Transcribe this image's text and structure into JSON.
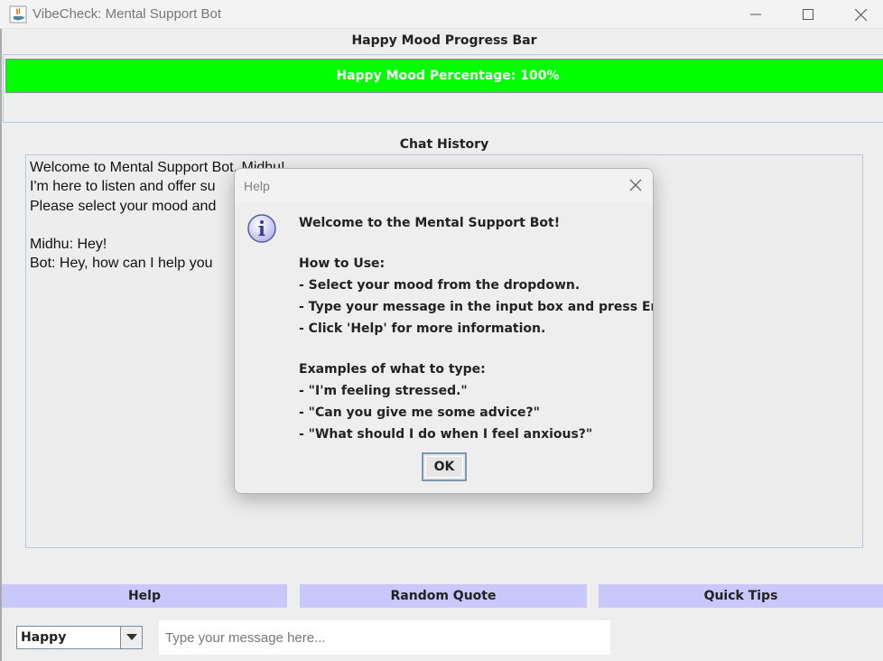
{
  "window": {
    "title": "VibeCheck: Mental Support Bot",
    "minimize_glyph": "—",
    "close_glyph": "✕"
  },
  "progress": {
    "title": "Happy Mood Progress Bar",
    "value_percent": 100,
    "label": "Happy Mood Percentage: 100%",
    "color": "#00ff00"
  },
  "chat": {
    "title": "Chat History",
    "lines": [
      "Welcome to Mental Support Bot, Midhu!",
      "I'm here to listen and offer su",
      "Please select your mood and",
      "",
      "Midhu: Hey!",
      "Bot: Hey, how can I help you"
    ]
  },
  "buttons": {
    "help": "Help",
    "random_quote": "Random Quote",
    "quick_tips": "Quick Tips",
    "color": "#c8c8fa"
  },
  "mood": {
    "selected": "Happy"
  },
  "input": {
    "placeholder": "Type your message here..."
  },
  "dialog": {
    "title": "Help",
    "heading": "Welcome to the Mental Support Bot!",
    "how_to_title": "How to Use:",
    "how_to": [
      "- Select your mood from the dropdown.",
      "- Type your message in the input box and press Enter.",
      "- Click 'Help' for more information."
    ],
    "examples_title": "Examples of what to type:",
    "examples": [
      "- \"I'm feeling stressed.\"",
      "- \"Can you give me some advice?\"",
      "- \"What should I do when I feel anxious?\""
    ],
    "ok_label": "OK",
    "icon": "information-icon"
  }
}
